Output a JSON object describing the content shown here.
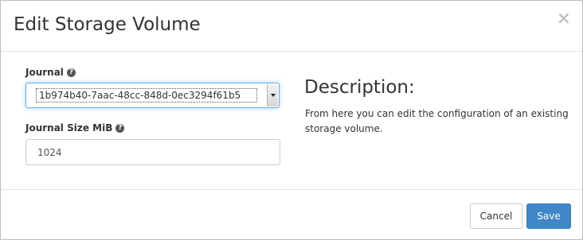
{
  "modal": {
    "title": "Edit Storage Volume",
    "close_symbol": "×"
  },
  "form": {
    "journal": {
      "label": "Journal",
      "help_icon": "?",
      "selected_value": "1b974b40-7aac-48cc-848d-0ec3294f61b5"
    },
    "journal_size": {
      "label": "Journal Size MiB",
      "help_icon": "?",
      "value": "1024"
    }
  },
  "description": {
    "title": "Description:",
    "text": "From here you can edit the configuration of an existing storage volume."
  },
  "footer": {
    "cancel_label": "Cancel",
    "save_label": "Save"
  },
  "colors": {
    "primary": "#3f87c7",
    "focus_border": "#66afe9",
    "close": "#c2c2c2"
  },
  "icons": {
    "close": "close-icon",
    "help": "question-circle-icon",
    "dropdown": "chevron-down-icon"
  }
}
